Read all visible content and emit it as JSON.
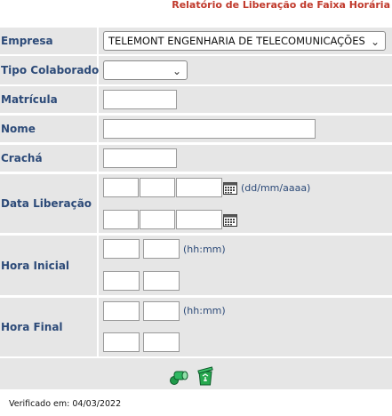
{
  "page": {
    "title": "Relatório de Liberação de Faixa Horária"
  },
  "form": {
    "empresa": {
      "label": "Empresa",
      "selected": "TELEMONT ENGENHARIA DE TELECOMUNICAÇÕES"
    },
    "tipo_colaborador": {
      "label": "Tipo Colaborador",
      "selected": ""
    },
    "matricula": {
      "label": "Matrícula",
      "value": ""
    },
    "nome": {
      "label": "Nome",
      "value": ""
    },
    "cracha": {
      "label": "Crachá",
      "value": ""
    },
    "data_liberacao": {
      "label": "Data Liberação",
      "hint": "(dd/mm/aaaa)"
    },
    "hora_inicial": {
      "label": "Hora Inicial",
      "hint": "(hh:mm)"
    },
    "hora_final": {
      "label": "Hora Final",
      "hint": "(hh:mm)"
    }
  },
  "actions": {
    "search_icon": "green-binoculars-search-icon",
    "clear_icon": "green-recycle-bin-clear-icon"
  },
  "footer": {
    "verified": "Verificado em: 04/03/2022"
  },
  "colors": {
    "label_text": "#2c4a78",
    "title_text": "#c0392b",
    "row_bg": "#e6e6e6"
  }
}
